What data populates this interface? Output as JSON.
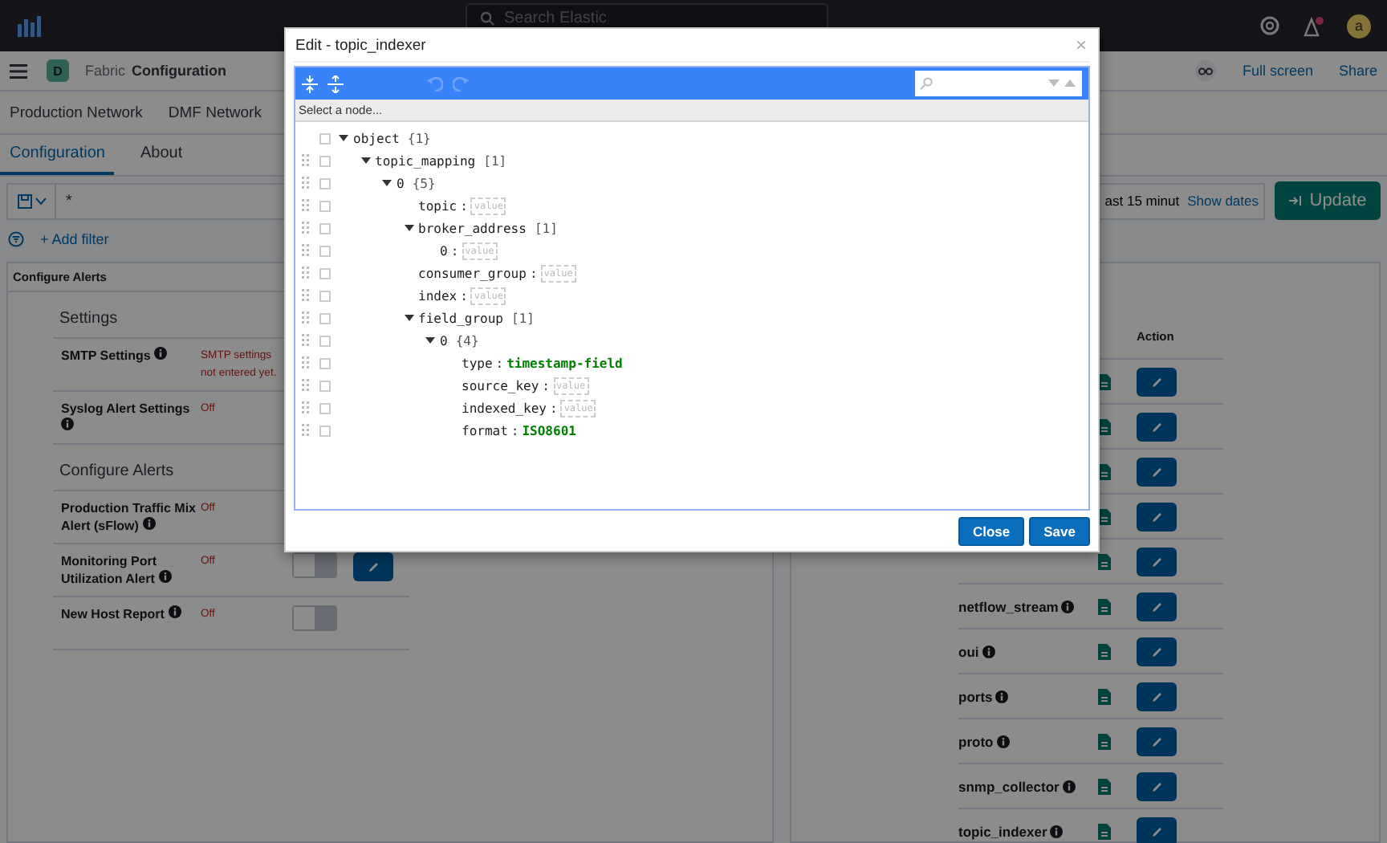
{
  "top_bar": {
    "search": {
      "placeholder": "Search Elastic"
    },
    "notification_dot": true,
    "avatar": "a"
  },
  "header": {
    "space_badge": "D",
    "breadcrumbs": [
      "Fabric",
      "Configuration"
    ],
    "links": [
      "Full screen",
      "Share"
    ]
  },
  "app_tabs": [
    {
      "label": "Production Network",
      "selected": false
    },
    {
      "label": "DMF Network",
      "selected": false
    }
  ],
  "tabs": [
    {
      "label": "Configuration",
      "selected": true
    },
    {
      "label": "About",
      "selected": false
    }
  ],
  "query_bar": {
    "query": "*",
    "time_range": "ast 15 minut",
    "show_dates": "Show dates",
    "update": "Update",
    "add_filter": "+ Add filter"
  },
  "alerts_panel": {
    "title": "Configure Alerts",
    "sections": [
      {
        "heading": "Settings",
        "rows": [
          {
            "label": "SMTP Settings",
            "status": "SMTP settings not entered yet."
          },
          {
            "label": "Syslog Alert Settings",
            "status": "Off"
          }
        ]
      },
      {
        "heading": "Configure Alerts",
        "rows": [
          {
            "label": "Production Traffic Mix Alert (sFlow)",
            "status": "Off"
          },
          {
            "label": "Monitoring Port Utilization Alert",
            "status": "Off",
            "on": false,
            "edit": true
          },
          {
            "label": "New Host Report",
            "status": "Off",
            "on": false
          }
        ]
      }
    ]
  },
  "table": {
    "columns": [
      "Action"
    ],
    "rows": [
      {},
      {},
      {},
      {},
      {},
      {
        "name": "netflow_stream"
      },
      {
        "name": "oui"
      },
      {
        "name": "ports"
      },
      {
        "name": "proto"
      },
      {
        "name": "snmp_collector"
      },
      {
        "name": "topic_indexer"
      }
    ]
  },
  "dialog": {
    "title": "Edit - topic_indexer",
    "close": "×",
    "breadcrumb": "Select a node...",
    "tree": [
      {
        "key": "object",
        "count": "{1}",
        "expanded": true,
        "checked": false,
        "children": [
          {
            "key": "topic_mapping",
            "count": "[1]",
            "expanded": true,
            "checked": false,
            "children": [
              {
                "key": "0",
                "count": "{5}",
                "expanded": true,
                "checked": false,
                "children": [
                  {
                    "key": "topic",
                    "sep": ":",
                    "placeholder": "value",
                    "checked": false
                  },
                  {
                    "key": "broker_address",
                    "count": "[1]",
                    "expanded": true,
                    "checked": false,
                    "children": [
                      {
                        "key": "0",
                        "sep": ":",
                        "placeholder": "value",
                        "checked": false
                      }
                    ]
                  },
                  {
                    "key": "consumer_group",
                    "sep": ":",
                    "placeholder": "value",
                    "checked": false
                  },
                  {
                    "key": "index",
                    "sep": ":",
                    "placeholder": "value",
                    "checked": false
                  },
                  {
                    "key": "field_group",
                    "count": "[1]",
                    "expanded": true,
                    "checked": false,
                    "children": [
                      {
                        "key": "0",
                        "count": "{4}",
                        "expanded": true,
                        "checked": false,
                        "children": [
                          {
                            "key": "type",
                            "sep": ":",
                            "value": "timestamp-field",
                            "checked": false
                          },
                          {
                            "key": "source_key",
                            "sep": ":",
                            "placeholder": "value",
                            "checked": false
                          },
                          {
                            "key": "indexed_key",
                            "sep": ":",
                            "placeholder": "value",
                            "checked": false
                          },
                          {
                            "key": "format",
                            "sep": ":",
                            "value": "ISO8601",
                            "checked": false
                          }
                        ]
                      }
                    ]
                  }
                ]
              }
            ]
          }
        ]
      }
    ],
    "buttons": [
      "Close",
      "Save"
    ]
  }
}
